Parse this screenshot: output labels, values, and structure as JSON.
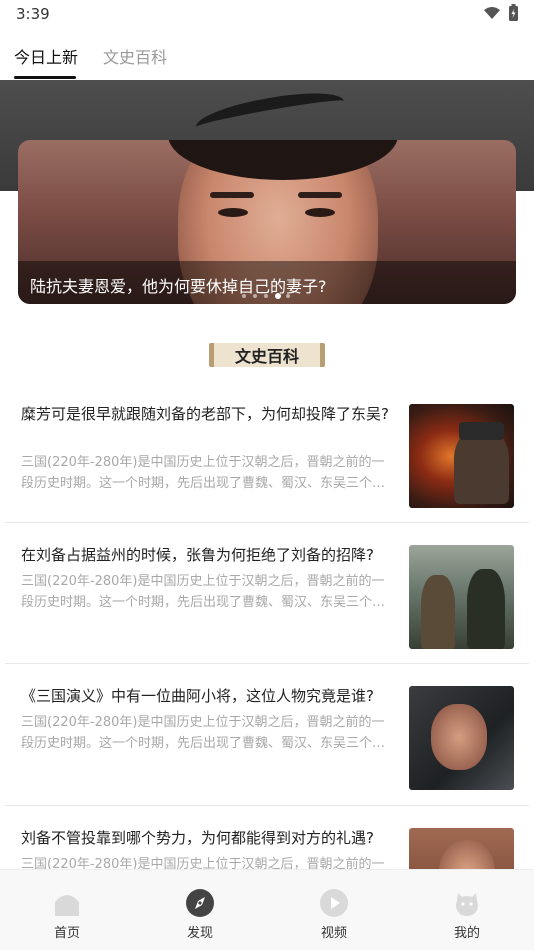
{
  "status_bar": {
    "time": "3:39"
  },
  "tabs": [
    {
      "label": "今日上新",
      "active": true
    },
    {
      "label": "文史百科",
      "active": false
    }
  ],
  "banner": {
    "caption": "陆抗夫妻恩爱，他为何要休掉自己的妻子?",
    "dot_count": 5,
    "active_dot": 4
  },
  "section": {
    "title": "文史百科"
  },
  "articles": [
    {
      "title": "糜芳可是很早就跟随刘备的老部下，为何却投降了东吴?",
      "summary": "三国(220年-280年)是中国历史上位于汉朝之后，晋朝之前的一段历史时期。这一个时期，先后出现了曹魏、蜀汉、东吴三个政权。"
    },
    {
      "title": "在刘备占据益州的时候，张鲁为何拒绝了刘备的招降?",
      "summary": "三国(220年-280年)是中国历史上位于汉朝之后，晋朝之前的一段历史时期。这一个时期，先后出现了曹魏、蜀汉、东吴三个政权。"
    },
    {
      "title": "《三国演义》中有一位曲阿小将，这位人物究竟是谁?",
      "summary": "三国(220年-280年)是中国历史上位于汉朝之后，晋朝之前的一段历史时期。这一个时期，先后出现了曹魏、蜀汉、东吴三个政权。"
    },
    {
      "title": "刘备不管投靠到哪个势力，为何都能得到对方的礼遇?",
      "summary": "三国(220年-280年)是中国历史上位于汉朝之后，晋朝之前的一"
    }
  ],
  "bottom_nav": [
    {
      "label": "首页",
      "icon": "home-icon"
    },
    {
      "label": "发现",
      "icon": "compass-icon",
      "active": true
    },
    {
      "label": "视频",
      "icon": "play-icon"
    },
    {
      "label": "我的",
      "icon": "profile-icon"
    }
  ],
  "colors": {
    "text_primary": "#222222",
    "text_secondary": "#a8a8a8",
    "tab_inactive": "#999999",
    "nav_icon_inactive": "#d9d9d9",
    "nav_icon_active": "#444444"
  }
}
